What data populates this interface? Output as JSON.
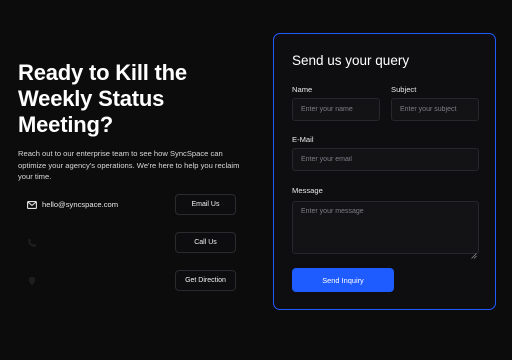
{
  "hero": {
    "headline": "Ready to Kill the Weekly Status Meeting?",
    "description": "Reach out to our enterprise team to see how SyncSpace can optimize your agency's operations. We're here to help you reclaim your time."
  },
  "contacts": [
    {
      "icon": "mail-icon",
      "text": "hello@syncspace.com",
      "button": "Email Us"
    },
    {
      "icon": "phone-icon",
      "text": "",
      "button": "Call Us"
    },
    {
      "icon": "location-icon",
      "text": "",
      "button": "Get Direction"
    }
  ],
  "form": {
    "title": "Send us your query",
    "name_label": "Name",
    "name_placeholder": "Enter your name",
    "subject_label": "Subject",
    "subject_placeholder": "Enter your subject",
    "email_label": "E-Mail",
    "email_placeholder": "Enter your email",
    "message_label": "Message",
    "message_placeholder": "Enter your message",
    "submit_label": "Send Inquiry"
  },
  "colors": {
    "background": "#0c0c0d",
    "accent": "#1f5cff",
    "card_border": "#1f5cff"
  }
}
